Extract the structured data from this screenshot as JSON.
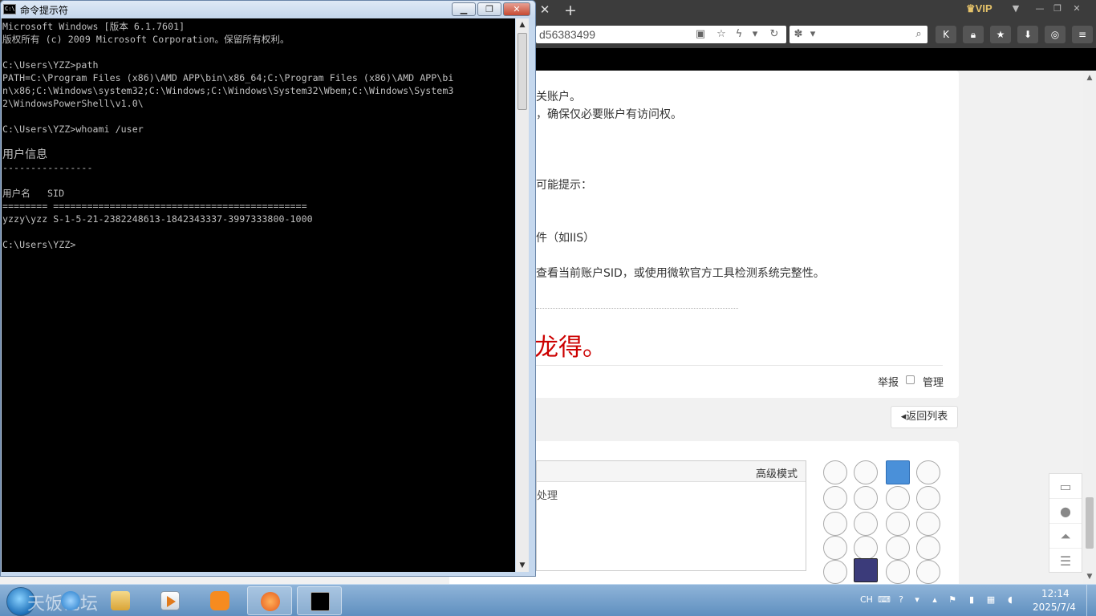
{
  "browser": {
    "address_fragment": "d56383499",
    "vip_label": "VIP",
    "article": {
      "line1": "关账户。",
      "line2": "，确保仅必要账户有访问权。",
      "line3": "可能提示：",
      "line4": "件（如IIS）",
      "line5": "查看当前账户SID，或使用微软官方工具检测系统完整性。",
      "big_red": "龙得。"
    },
    "post_actions": {
      "report": "举报",
      "manage": "管理"
    },
    "back_to_list": "返回列表",
    "editor": {
      "advanced_mode": "高级模式",
      "content_fragment": "处理"
    }
  },
  "cmd": {
    "title": "命令提示符",
    "icon_label": "C:\\",
    "lines": [
      "Microsoft Windows [版本 6.1.7601]",
      "版权所有 (c) 2009 Microsoft Corporation。保留所有权利。",
      "",
      "C:\\Users\\YZZ>path",
      "PATH=C:\\Program Files (x86)\\AMD APP\\bin\\x86_64;C:\\Program Files (x86)\\AMD APP\\bi",
      "n\\x86;C:\\Windows\\system32;C:\\Windows;C:\\Windows\\System32\\Wbem;C:\\Windows\\System3",
      "2\\WindowsPowerShell\\v1.0\\",
      "",
      "C:\\Users\\YZZ>whoami /user",
      "",
      "用户信息",
      "----------------",
      "",
      "用户名   SID",
      "======== =============================================",
      "yzzy\\yzz S-1-5-21-2382248613-1842343337-3997333800-1000",
      "",
      "C:\\Users\\YZZ>"
    ]
  },
  "taskbar": {
    "watermark": "天饭论坛",
    "language": "CH",
    "clock": {
      "time": "12:14",
      "date": "2025/7/4"
    }
  },
  "colors": {
    "console_bg": "#000000",
    "console_text": "#c0c0c0",
    "taskbar": "#6f9ccb",
    "accent_red": "#cc0000"
  },
  "icons": {
    "start": "windows-orb-icon",
    "ie": "internet-explorer-icon",
    "explorer": "folder-icon",
    "media": "media-player-icon",
    "cmd": "console-icon"
  }
}
